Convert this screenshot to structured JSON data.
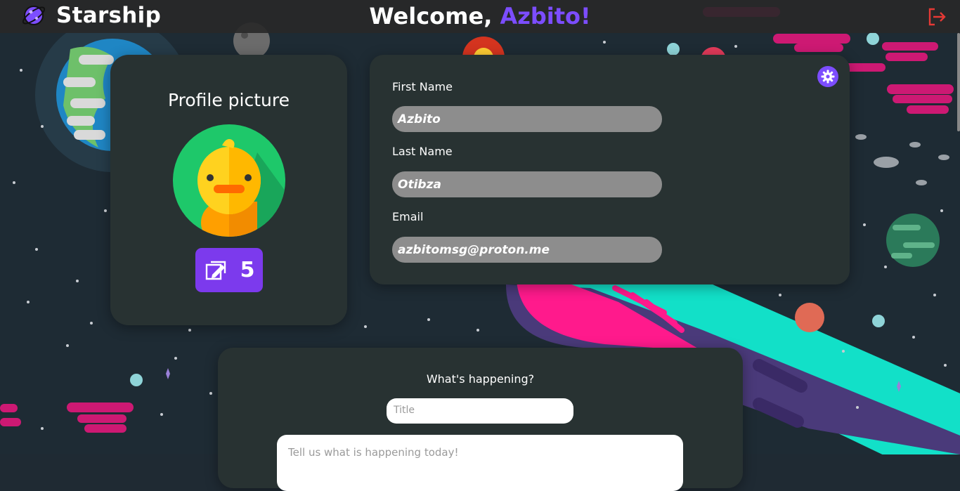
{
  "header": {
    "app_name": "Starship",
    "welcome_prefix": "Welcome, ",
    "username": "Azbito!",
    "logo_icon": "planet-logo-icon",
    "logout_icon": "logout-icon"
  },
  "profile": {
    "title": "Profile picture",
    "avatar_icon": "duck-avatar-icon",
    "badge_icon": "paper-edit-icon",
    "badge_count": "5"
  },
  "info": {
    "settings_icon": "gear-icon",
    "first_name_label": "First Name",
    "first_name_value": "Azbito",
    "last_name_label": "Last Name",
    "last_name_value": "Otibza",
    "email_label": "Email",
    "email_value": "azbitomsg@proton.me"
  },
  "post": {
    "question": "What's happening?",
    "title_placeholder": "Title",
    "body_placeholder": "Tell us what is happening today!"
  },
  "colors": {
    "accent": "#7c4dff",
    "card": "#283232",
    "logout": "#e53935"
  }
}
